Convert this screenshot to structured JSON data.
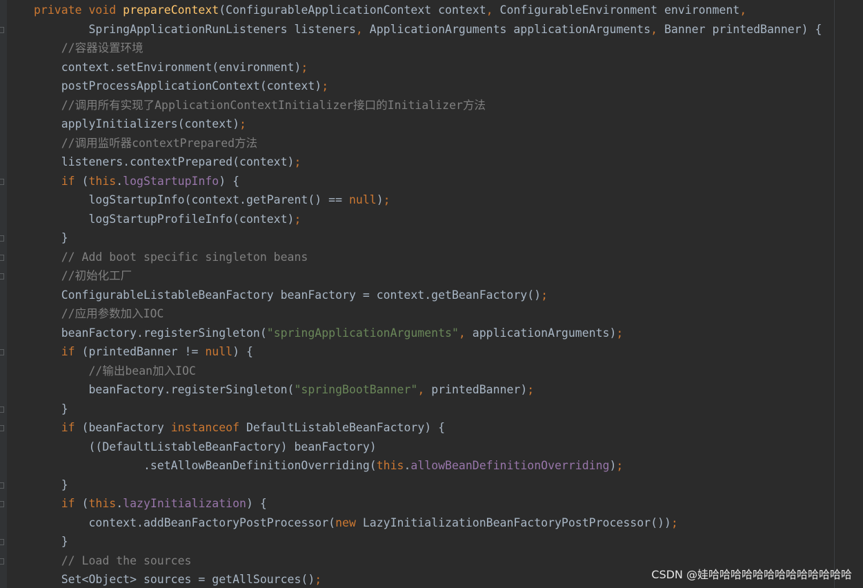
{
  "editor": {
    "theme": "darcula",
    "colors": {
      "background": "#2b2b2b",
      "keyword": "#cc7832",
      "method_decl": "#ffc66d",
      "plain": "#a9b7c6",
      "comment": "#808080",
      "field": "#9876aa",
      "string": "#6a8759"
    },
    "lines": [
      [
        [
          "keyword",
          "private "
        ],
        [
          "keyword",
          "void "
        ],
        [
          "method-decl",
          "prepareContext"
        ],
        [
          "plain",
          "(ConfigurableApplicationContext context"
        ],
        [
          "punct",
          ", "
        ],
        [
          "plain",
          "ConfigurableEnvironment environment"
        ],
        [
          "punct",
          ","
        ]
      ],
      [
        [
          "plain",
          "        SpringApplicationRunListeners listeners"
        ],
        [
          "punct",
          ", "
        ],
        [
          "plain",
          "ApplicationArguments applicationArguments"
        ],
        [
          "punct",
          ", "
        ],
        [
          "plain",
          "Banner printedBanner) {"
        ]
      ],
      [
        [
          "comment",
          "    //容器设置环境"
        ]
      ],
      [
        [
          "plain",
          "    context.setEnvironment(environment)"
        ],
        [
          "punct",
          ";"
        ]
      ],
      [
        [
          "plain",
          "    postProcessApplicationContext(context)"
        ],
        [
          "punct",
          ";"
        ]
      ],
      [
        [
          "comment",
          "    //调用所有实现了ApplicationContextInitializer接口的Initializer方法"
        ]
      ],
      [
        [
          "plain",
          "    applyInitializers(context)"
        ],
        [
          "punct",
          ";"
        ]
      ],
      [
        [
          "comment",
          "    //调用监听器contextPrepared方法"
        ]
      ],
      [
        [
          "plain",
          "    listeners.contextPrepared(context)"
        ],
        [
          "punct",
          ";"
        ]
      ],
      [
        [
          "keyword",
          "    if "
        ],
        [
          "plain",
          "("
        ],
        [
          "keyword",
          "this"
        ],
        [
          "plain",
          "."
        ],
        [
          "field",
          "logStartupInfo"
        ],
        [
          "plain",
          ") {"
        ]
      ],
      [
        [
          "plain",
          "        logStartupInfo(context.getParent() == "
        ],
        [
          "keyword",
          "null"
        ],
        [
          "plain",
          ")"
        ],
        [
          "punct",
          ";"
        ]
      ],
      [
        [
          "plain",
          "        logStartupProfileInfo(context)"
        ],
        [
          "punct",
          ";"
        ]
      ],
      [
        [
          "plain",
          "    }"
        ]
      ],
      [
        [
          "comment",
          "    // Add boot specific singleton beans"
        ]
      ],
      [
        [
          "comment",
          "    //初始化工厂"
        ]
      ],
      [
        [
          "plain",
          "    ConfigurableListableBeanFactory beanFactory = context.getBeanFactory()"
        ],
        [
          "punct",
          ";"
        ]
      ],
      [
        [
          "comment",
          "    //应用参数加入IOC"
        ]
      ],
      [
        [
          "plain",
          "    beanFactory.registerSingleton("
        ],
        [
          "string",
          "\"springApplicationArguments\""
        ],
        [
          "punct",
          ", "
        ],
        [
          "plain",
          "applicationArguments)"
        ],
        [
          "punct",
          ";"
        ]
      ],
      [
        [
          "keyword",
          "    if "
        ],
        [
          "plain",
          "(printedBanner != "
        ],
        [
          "keyword",
          "null"
        ],
        [
          "plain",
          ") {"
        ]
      ],
      [
        [
          "comment",
          "        //输出bean加入IOC"
        ]
      ],
      [
        [
          "plain",
          "        beanFactory.registerSingleton("
        ],
        [
          "string",
          "\"springBootBanner\""
        ],
        [
          "punct",
          ", "
        ],
        [
          "plain",
          "printedBanner)"
        ],
        [
          "punct",
          ";"
        ]
      ],
      [
        [
          "plain",
          "    }"
        ]
      ],
      [
        [
          "keyword",
          "    if "
        ],
        [
          "plain",
          "(beanFactory "
        ],
        [
          "keyword",
          "instanceof "
        ],
        [
          "plain",
          "DefaultListableBeanFactory) {"
        ]
      ],
      [
        [
          "plain",
          "        ((DefaultListableBeanFactory) beanFactory)"
        ]
      ],
      [
        [
          "plain",
          "                .setAllowBeanDefinitionOverriding("
        ],
        [
          "keyword",
          "this"
        ],
        [
          "plain",
          "."
        ],
        [
          "field",
          "allowBeanDefinitionOverriding"
        ],
        [
          "plain",
          ")"
        ],
        [
          "punct",
          ";"
        ]
      ],
      [
        [
          "plain",
          "    }"
        ]
      ],
      [
        [
          "keyword",
          "    if "
        ],
        [
          "plain",
          "("
        ],
        [
          "keyword",
          "this"
        ],
        [
          "plain",
          "."
        ],
        [
          "field",
          "lazyInitialization"
        ],
        [
          "plain",
          ") {"
        ]
      ],
      [
        [
          "plain",
          "        context.addBeanFactoryPostProcessor("
        ],
        [
          "keyword",
          "new "
        ],
        [
          "plain",
          "LazyInitializationBeanFactoryPostProcessor())"
        ],
        [
          "punct",
          ";"
        ]
      ],
      [
        [
          "plain",
          "    }"
        ]
      ],
      [
        [
          "comment",
          "    // Load the sources"
        ]
      ],
      [
        [
          "plain",
          "    Set<Object> sources = getAllSources()"
        ],
        [
          "punct",
          ";"
        ]
      ]
    ]
  },
  "watermark": {
    "text": "CSDN @娃哈哈哈哈哈哈哈哈哈哈哈哈哈"
  }
}
